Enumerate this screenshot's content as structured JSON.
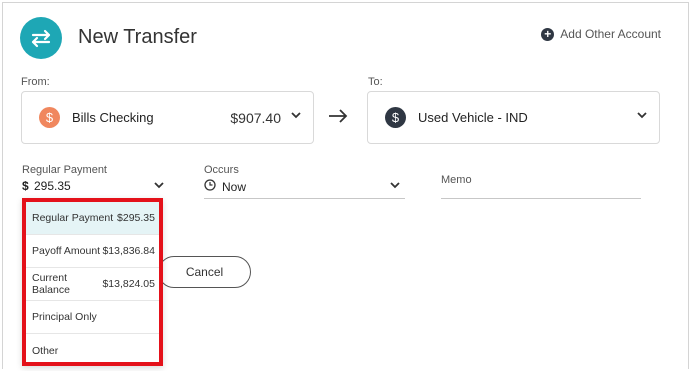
{
  "header": {
    "title": "New Transfer",
    "add_other_account": "Add Other Account"
  },
  "from": {
    "label": "From:",
    "account": "Bills Checking",
    "amount": "$907.40",
    "icon": "dollar-icon",
    "icon_color": "#f0875e"
  },
  "to": {
    "label": "To:",
    "account": "Used Vehicle - IND",
    "icon": "dollar-icon",
    "icon_color": "#2f3743"
  },
  "payment": {
    "label": "Regular Payment",
    "currency": "$",
    "value": "295.35"
  },
  "occurs": {
    "label": "Occurs",
    "value": "Now"
  },
  "memo": {
    "label": "Memo"
  },
  "dropdown": {
    "items": [
      {
        "label": "Regular Payment",
        "value": "$295.35"
      },
      {
        "label": "Payoff Amount",
        "value": "$13,836.84"
      },
      {
        "label": "Current Balance",
        "value": "$13,824.05"
      },
      {
        "label": "Principal Only",
        "value": ""
      },
      {
        "label": "Other",
        "value": ""
      }
    ],
    "highlight_color": "#e4111a"
  },
  "buttons": {
    "cancel": "Cancel"
  },
  "colors": {
    "accent": "#1ea7b5"
  }
}
